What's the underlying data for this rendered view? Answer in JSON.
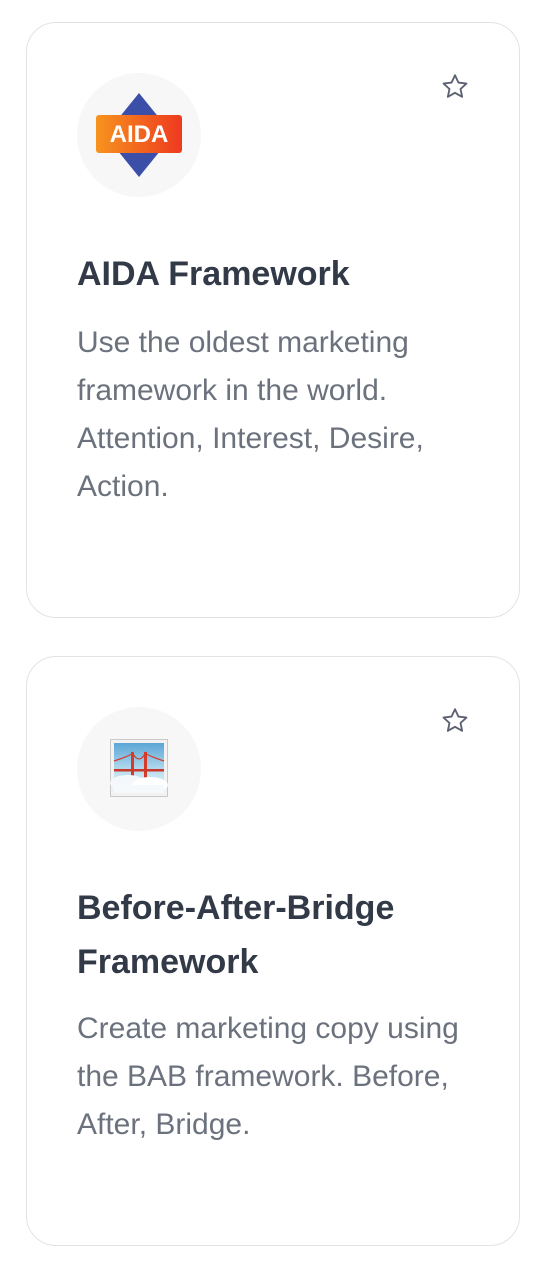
{
  "cards": [
    {
      "title": "AIDA Framework",
      "description": "Use the oldest marketing framework in the world. Attention, Interest, Desire, Action.",
      "logo_text": "AIDA",
      "icon": "aida-logo",
      "favorite_icon": "star-outline-icon"
    },
    {
      "title": "Before-After-Bridge Framework",
      "description": "Create marketing copy using the BAB framework. Before, After, Bridge.",
      "icon": "bridge-image-thumbnail",
      "favorite_icon": "star-outline-icon"
    }
  ],
  "colors": {
    "title": "#323a48",
    "description": "#6c727d",
    "card_border": "#e2e3e6",
    "aida_orange": "#f05a1c",
    "aida_blue": "#3c4fa8",
    "star_stroke": "#5b6170"
  }
}
